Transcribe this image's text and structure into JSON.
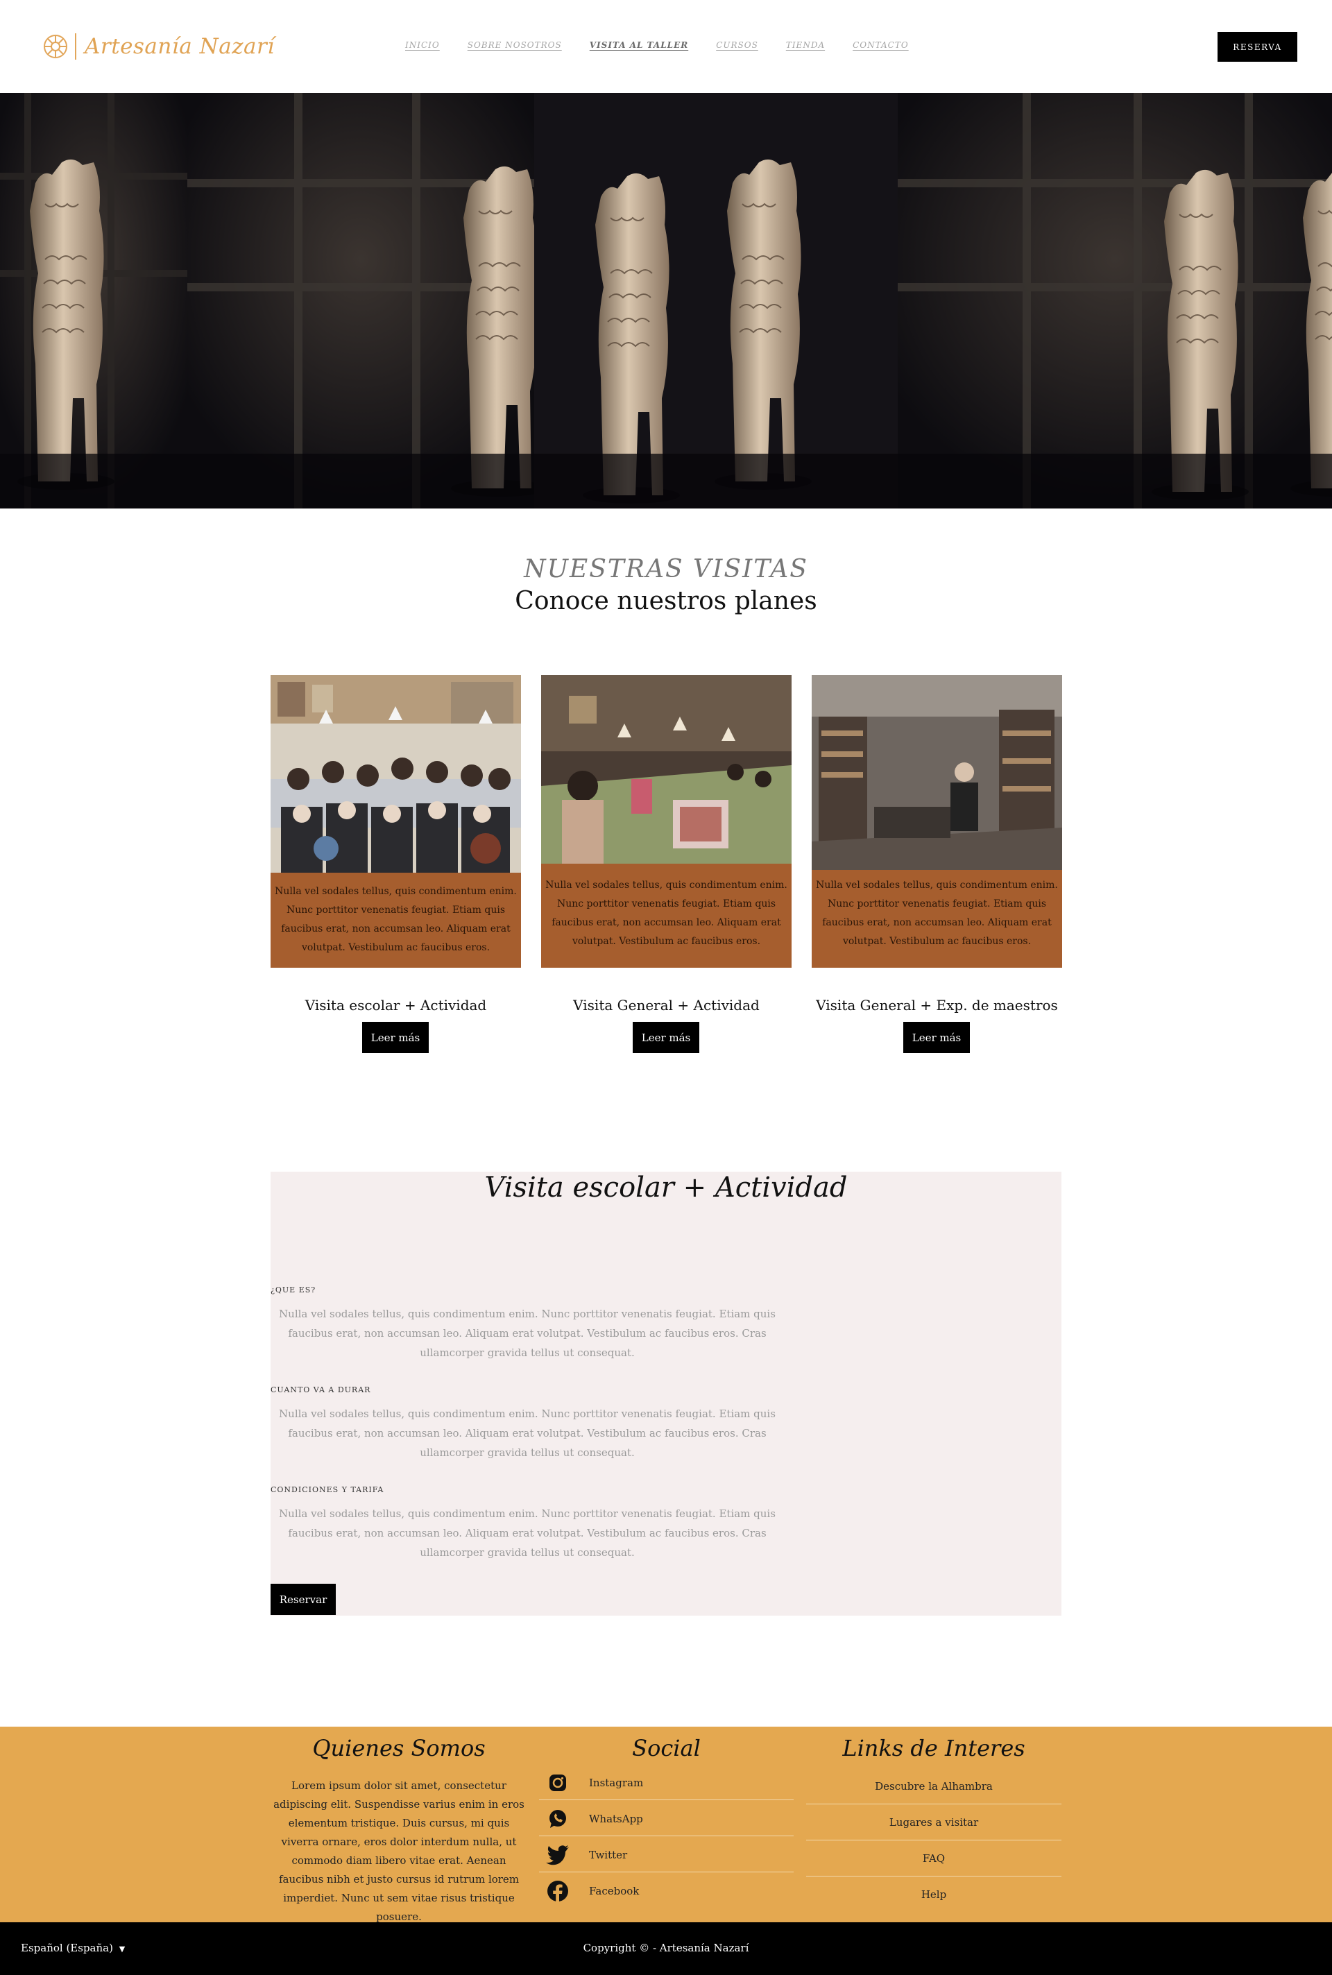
{
  "header": {
    "brand": "Artesanía Nazarí",
    "nav": [
      "INICIO",
      "SOBRE NOSOTROS",
      "VISITA AL TALLER",
      "CURSOS",
      "TIENDA",
      "CONTACTO"
    ],
    "active_nav": "VISITA AL TALLER",
    "reserve_button": "RESERVA"
  },
  "visits": {
    "kicker": "NUESTRAS VISITAS",
    "title": "Conoce nuestros planes",
    "cards": [
      {
        "text": "Nulla vel sodales tellus, quis condimentum enim. Nunc porttitor venenatis feugiat. Etiam quis faucibus erat, non accumsan leo. Aliquam erat volutpat. Vestibulum ac faucibus eros.",
        "title": "Visita escolar + Actividad",
        "button": "Leer más"
      },
      {
        "text": "Nulla vel sodales tellus, quis condimentum enim. Nunc porttitor venenatis feugiat. Etiam quis faucibus erat, non accumsan leo. Aliquam erat volutpat. Vestibulum ac faucibus eros.",
        "title": "Visita General + Actividad",
        "button": "Leer más"
      },
      {
        "text": "Nulla vel sodales tellus, quis condimentum enim. Nunc porttitor venenatis feugiat. Etiam quis faucibus erat, non accumsan leo. Aliquam erat volutpat. Vestibulum ac faucibus eros.",
        "title": "Visita General + Exp. de maestros",
        "button": "Leer más"
      }
    ]
  },
  "detail": {
    "title": "Visita escolar + Actividad",
    "sections": [
      {
        "heading": "¿QUE ES?",
        "body": "Nulla vel sodales tellus, quis condimentum enim. Nunc porttitor venenatis feugiat. Etiam quis faucibus erat, non accumsan leo. Aliquam erat volutpat. Vestibulum ac faucibus eros. Cras ullamcorper gravida tellus ut consequat."
      },
      {
        "heading": "CUANTO VA A DURAR",
        "body": "Nulla vel sodales tellus, quis condimentum enim. Nunc porttitor venenatis feugiat. Etiam quis faucibus erat, non accumsan leo. Aliquam erat volutpat. Vestibulum ac faucibus eros. Cras ullamcorper gravida tellus ut consequat."
      },
      {
        "heading": "CONDICIONES Y TARIFA",
        "body": "Nulla vel sodales tellus, quis condimentum enim. Nunc porttitor venenatis feugiat. Etiam quis faucibus erat, non accumsan leo. Aliquam erat volutpat. Vestibulum ac faucibus eros. Cras ullamcorper gravida tellus ut consequat."
      }
    ],
    "button": "Reservar"
  },
  "footer": {
    "about_title": "Quienes Somos",
    "about_text": "Lorem ipsum dolor sit amet, consectetur adipiscing elit. Suspendisse varius enim in eros elementum tristique. Duis cursus, mi quis viverra ornare, eros dolor interdum nulla, ut commodo diam libero vitae erat. Aenean faucibus nibh et justo cursus id rutrum lorem imperdiet. Nunc ut sem vitae risus tristique posuere.",
    "social_title": "Social",
    "social": [
      {
        "label": "Instagram",
        "icon": "instagram-icon"
      },
      {
        "label": "WhatsApp",
        "icon": "whatsapp-icon"
      },
      {
        "label": "Twitter",
        "icon": "twitter-icon"
      },
      {
        "label": "Facebook",
        "icon": "facebook-icon"
      }
    ],
    "links_title": "Links de Interes",
    "links": [
      "Descubre la Alhambra",
      "Lugares a visitar",
      "FAQ",
      "Help"
    ]
  },
  "bottom": {
    "language": "Español (España)",
    "copyright": "Copyright © - Artesanía Nazarí"
  },
  "colors": {
    "accent": "#e4a850",
    "card": "#a65e2e",
    "detail_bg": "#f5eeee",
    "logo": "#e0a354"
  }
}
